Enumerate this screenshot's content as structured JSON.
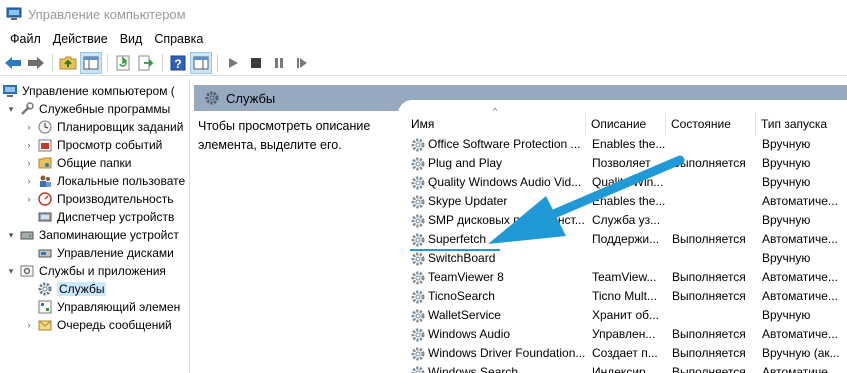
{
  "window": {
    "title": "Управление компьютером"
  },
  "menu": {
    "file": "Файл",
    "action": "Действие",
    "view": "Вид",
    "help": "Справка"
  },
  "toolbar_icons": [
    "back-arrow-icon",
    "forward-arrow-icon",
    "up-folder-icon",
    "show-hide-tree-icon",
    "refresh-icon",
    "export-icon",
    "help-icon",
    "properties-icon",
    "play-icon",
    "stop-icon",
    "pause-icon",
    "restart-icon"
  ],
  "tree": {
    "items": [
      {
        "label": "Управление компьютером (",
        "level": 0,
        "expander": "",
        "icon": "computer-management-icon"
      },
      {
        "label": "Служебные программы",
        "level": 1,
        "expander": "▾",
        "icon": "tools-icon"
      },
      {
        "label": "Планировщик заданий",
        "level": 2,
        "expander": "›",
        "icon": "clock-icon"
      },
      {
        "label": "Просмотр событий",
        "level": 2,
        "expander": "›",
        "icon": "event-viewer-icon"
      },
      {
        "label": "Общие папки",
        "level": 2,
        "expander": "›",
        "icon": "shared-folder-icon"
      },
      {
        "label": "Локальные пользовате",
        "level": 2,
        "expander": "›",
        "icon": "users-icon"
      },
      {
        "label": "Производительность",
        "level": 2,
        "expander": "›",
        "icon": "performance-icon"
      },
      {
        "label": "Диспетчер устройств",
        "level": 2,
        "expander": "",
        "icon": "device-manager-icon"
      },
      {
        "label": "Запоминающие устройст",
        "level": 1,
        "expander": "▾",
        "icon": "storage-icon"
      },
      {
        "label": "Управление дисками",
        "level": 2,
        "expander": "",
        "icon": "disk-icon"
      },
      {
        "label": "Службы и приложения",
        "level": 1,
        "expander": "▾",
        "icon": "services-apps-icon"
      },
      {
        "label": "Службы",
        "level": 2,
        "expander": "",
        "icon": "services-gear-icon",
        "selected": true
      },
      {
        "label": "Управляющий элемен",
        "level": 2,
        "expander": "",
        "icon": "wmi-icon"
      },
      {
        "label": "Очередь сообщений",
        "level": 2,
        "expander": "›",
        "icon": "message-queue-icon"
      }
    ]
  },
  "main": {
    "header": "Службы",
    "description": "Чтобы просмотреть описание элемента, выделите его."
  },
  "services": {
    "columns": {
      "name": "Имя",
      "description": "Описание",
      "status": "Состояние",
      "startup": "Тип запуска"
    },
    "rows": [
      {
        "name": "Office Software Protection ...",
        "description": "Enables the...",
        "status": "",
        "startup": "Вручную"
      },
      {
        "name": "Plug and Play",
        "description": "Позволяет ...",
        "status": "Выполняется",
        "startup": "Вручную"
      },
      {
        "name": "Quality Windows Audio Vid...",
        "description": "Quality Win...",
        "status": "",
        "startup": "Вручную"
      },
      {
        "name": "Skype Updater",
        "description": "Enables the...",
        "status": "",
        "startup": "Автоматиче..."
      },
      {
        "name": "SMP дисковых пространст...",
        "description": "Служба уз...",
        "status": "",
        "startup": "Вручную"
      },
      {
        "name": "Superfetch",
        "description": "Поддержи...",
        "status": "Выполняется",
        "startup": "Автоматиче..."
      },
      {
        "name": "SwitchBoard",
        "description": "",
        "status": "",
        "startup": "Вручную"
      },
      {
        "name": "TeamViewer 8",
        "description": "TeamView...",
        "status": "Выполняется",
        "startup": "Автоматиче..."
      },
      {
        "name": "TicnoSearch",
        "description": "Ticno Mult...",
        "status": "Выполняется",
        "startup": "Автоматиче..."
      },
      {
        "name": "WalletService",
        "description": "Хранит об...",
        "status": "",
        "startup": "Вручную"
      },
      {
        "name": "Windows Audio",
        "description": "Управлен...",
        "status": "Выполняется",
        "startup": "Автоматиче..."
      },
      {
        "name": "Windows Driver Foundation...",
        "description": "Создает п...",
        "status": "Выполняется",
        "startup": "Вручную (ак..."
      },
      {
        "name": "Windows Search",
        "description": "Индексир...",
        "status": "Выполняется",
        "startup": "Автоматиче..."
      }
    ]
  },
  "colors": {
    "header_bar": "#97a9bf",
    "annotation_arrow": "#1f9ad6",
    "selection": "#cce8ff"
  }
}
